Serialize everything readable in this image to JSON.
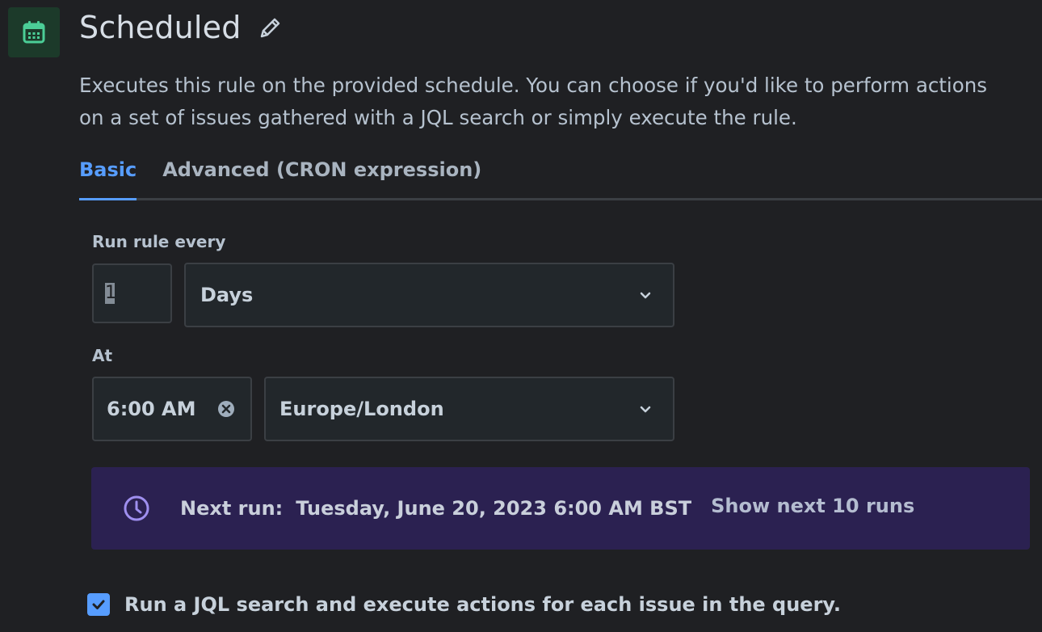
{
  "header": {
    "icon": "calendar-icon",
    "title": "Scheduled",
    "edit_icon": "pencil-icon"
  },
  "description": "Executes this rule on the provided schedule. You can choose if you'd like to perform actions\non a set of issues gathered with a JQL search or simply execute the rule.",
  "tabs": [
    {
      "label": "Basic",
      "active": true
    },
    {
      "label": "Advanced (CRON expression)",
      "active": false
    }
  ],
  "schedule": {
    "run_every_label": "Run rule every",
    "interval_value": "1",
    "interval_unit": "Days",
    "at_label": "At",
    "time_value": "6:00 AM",
    "timezone": "Europe/London"
  },
  "next_run": {
    "label": "Next run:",
    "value": "Tuesday, June 20, 2023 6:00 AM BST",
    "show_next_link": "Show next 10 runs"
  },
  "jql": {
    "checked": true,
    "label": "Run a JQL search and execute actions for each issue in the query."
  },
  "colors": {
    "background": "#1f2023",
    "accent": "#579dff",
    "banner": "#2b2151",
    "icon_green": "#4bce97",
    "clock_purple": "#9f8fef"
  }
}
